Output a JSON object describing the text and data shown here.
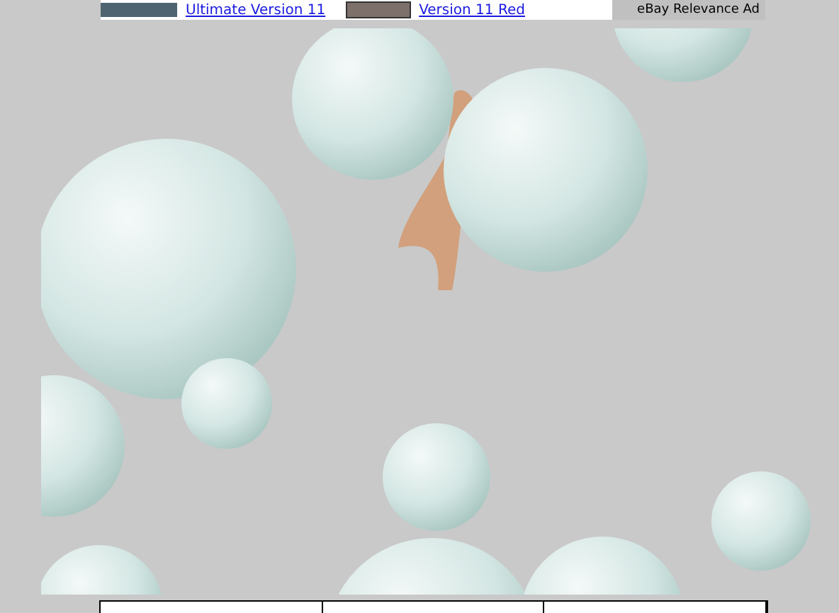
{
  "ad_banner": {
    "items": [
      {
        "label": "Ultimate Version 11"
      },
      {
        "label": "Version 11 Red"
      }
    ],
    "ad_label": "eBay Relevance Ad"
  }
}
